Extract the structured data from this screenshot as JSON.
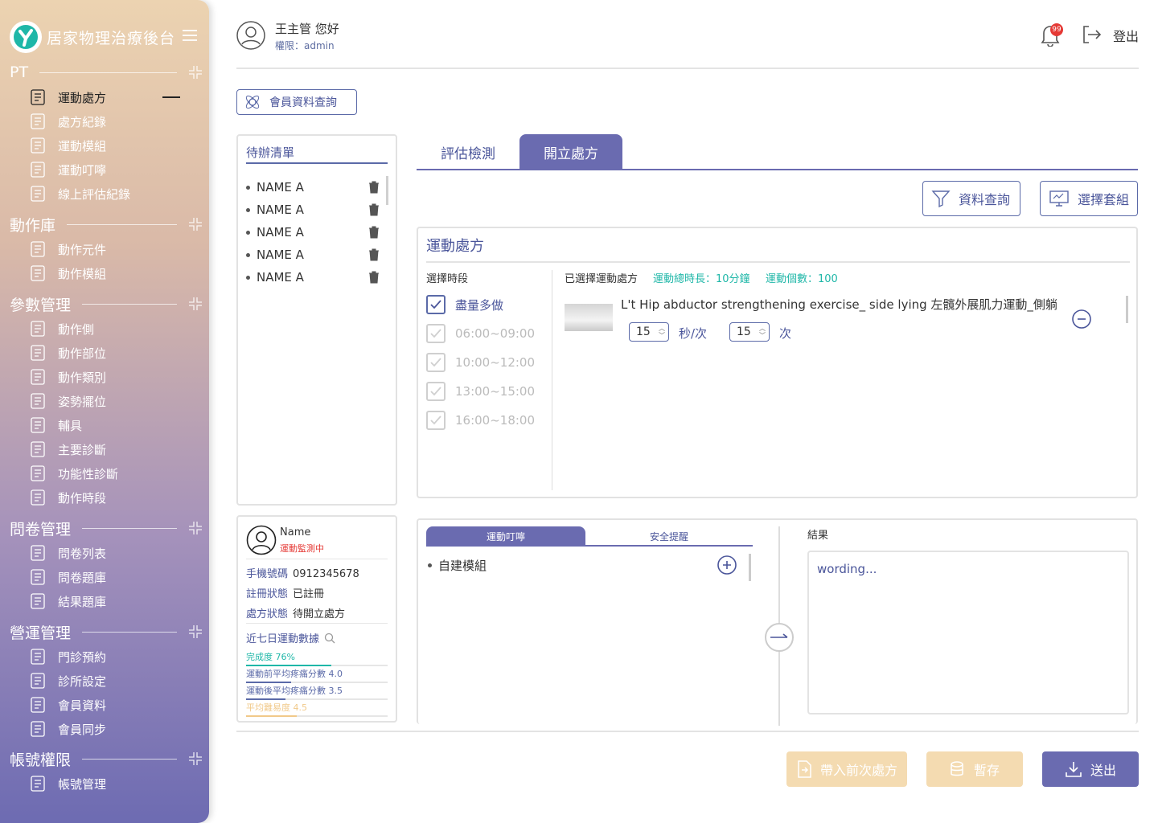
{
  "app": {
    "title": "居家物理治療後台",
    "brand_color": "#6a6bb0",
    "accent_teal": "#1fb7a8"
  },
  "header": {
    "greeting": "王主管 您好",
    "permission": "權限：admin",
    "notification_count": "99",
    "logout": "登出"
  },
  "sidebar": {
    "sections": [
      {
        "label": "PT",
        "items": [
          {
            "label": "運動處方",
            "icon": "prescription-icon",
            "active": true
          },
          {
            "label": "處方紀錄",
            "icon": "record-icon"
          },
          {
            "label": "運動模組",
            "icon": "module-icon"
          },
          {
            "label": "運動叮嚀",
            "icon": "reminder-icon"
          },
          {
            "label": "線上評估紀錄",
            "icon": "evaluation-icon"
          }
        ]
      },
      {
        "label": "動作庫",
        "items": [
          {
            "label": "動作元件",
            "icon": "component-icon"
          },
          {
            "label": "動作模組",
            "icon": "action-module-icon"
          }
        ]
      },
      {
        "label": "參數管理",
        "items": [
          {
            "label": "動作側",
            "icon": "side-icon"
          },
          {
            "label": "動作部位",
            "icon": "body-part-icon"
          },
          {
            "label": "動作類別",
            "icon": "category-icon"
          },
          {
            "label": "姿勢擺位",
            "icon": "posture-icon"
          },
          {
            "label": "輔具",
            "icon": "aid-icon"
          },
          {
            "label": "主要診斷",
            "icon": "diagnosis-icon"
          },
          {
            "label": "功能性診斷",
            "icon": "functional-diagnosis-icon"
          },
          {
            "label": "動作時段",
            "icon": "timer-icon"
          }
        ]
      },
      {
        "label": "問卷管理",
        "items": [
          {
            "label": "問卷列表",
            "icon": "questionnaire-list-icon"
          },
          {
            "label": "問卷題庫",
            "icon": "question-bank-icon"
          },
          {
            "label": "結果題庫",
            "icon": "result-bank-icon"
          }
        ]
      },
      {
        "label": "營運管理",
        "items": [
          {
            "label": "門診預約",
            "icon": "calendar-icon"
          },
          {
            "label": "診所設定",
            "icon": "clinic-settings-icon"
          },
          {
            "label": "會員資料",
            "icon": "member-card-icon"
          },
          {
            "label": "會員同步",
            "icon": "sync-icon"
          }
        ]
      },
      {
        "label": "帳號權限",
        "items": [
          {
            "label": "帳號管理",
            "icon": "account-management-icon"
          }
        ]
      }
    ]
  },
  "member_query_button": "會員資料查詢",
  "todo": {
    "title": "待辦清單",
    "items": [
      "NAME A",
      "NAME A",
      "NAME A",
      "NAME A",
      "NAME A"
    ]
  },
  "member_card": {
    "name": "Name",
    "status": "運動監測中",
    "phone_label": "手機號碼",
    "phone": "0912345678",
    "register_label": "註冊狀態",
    "register": "已註冊",
    "rx_label": "處方狀態",
    "rx": "待開立處方",
    "recent_title": "近七日運動數據",
    "stats": [
      {
        "label": "完成度 76%",
        "value": 0.76,
        "color": "#1fb7a8"
      },
      {
        "label": "運動前平均疼痛分數 4.0",
        "value": 0.4,
        "color": "#5b6aa8"
      },
      {
        "label": "運動後平均疼痛分數 3.5",
        "value": 0.35,
        "color": "#5b6aa8"
      },
      {
        "label": "平均難易度 4.5",
        "value": 0.45,
        "color": "#f1c98a"
      }
    ]
  },
  "tabs": {
    "eval": "評估檢測",
    "rx": "開立處方",
    "active": "rx"
  },
  "buttons": {
    "query": "資料查詢",
    "select_set": "選擇套組",
    "prev_rx": "帶入前次處方",
    "save": "暫存",
    "send": "送出"
  },
  "rx_panel": {
    "title": "運動處方",
    "period_title": "選擇時段",
    "periods": [
      {
        "label": "盡量多做",
        "checked": true,
        "disabled": false
      },
      {
        "label": "06:00~09:00",
        "checked": true,
        "disabled": true
      },
      {
        "label": "10:00~12:00",
        "checked": true,
        "disabled": true
      },
      {
        "label": "13:00~15:00",
        "checked": true,
        "disabled": true
      },
      {
        "label": "16:00~18:00",
        "checked": true,
        "disabled": true
      }
    ],
    "selected_title": "已選擇運動處方",
    "total_duration": "運動總時長：10分鐘",
    "total_count": "運動個數：100",
    "exercise": {
      "name": "L't Hip abductor strengthening exercise_ side lying 左髖外展肌力運動_側躺",
      "seconds": "15",
      "seconds_unit": "秒/次",
      "reps": "15",
      "reps_unit": "次"
    }
  },
  "bottom_panel": {
    "subtab_a": "運動叮嚀",
    "subtab_b": "安全提醒",
    "self_module": "自建模組",
    "result_title": "結果",
    "result_text": "wording..."
  }
}
